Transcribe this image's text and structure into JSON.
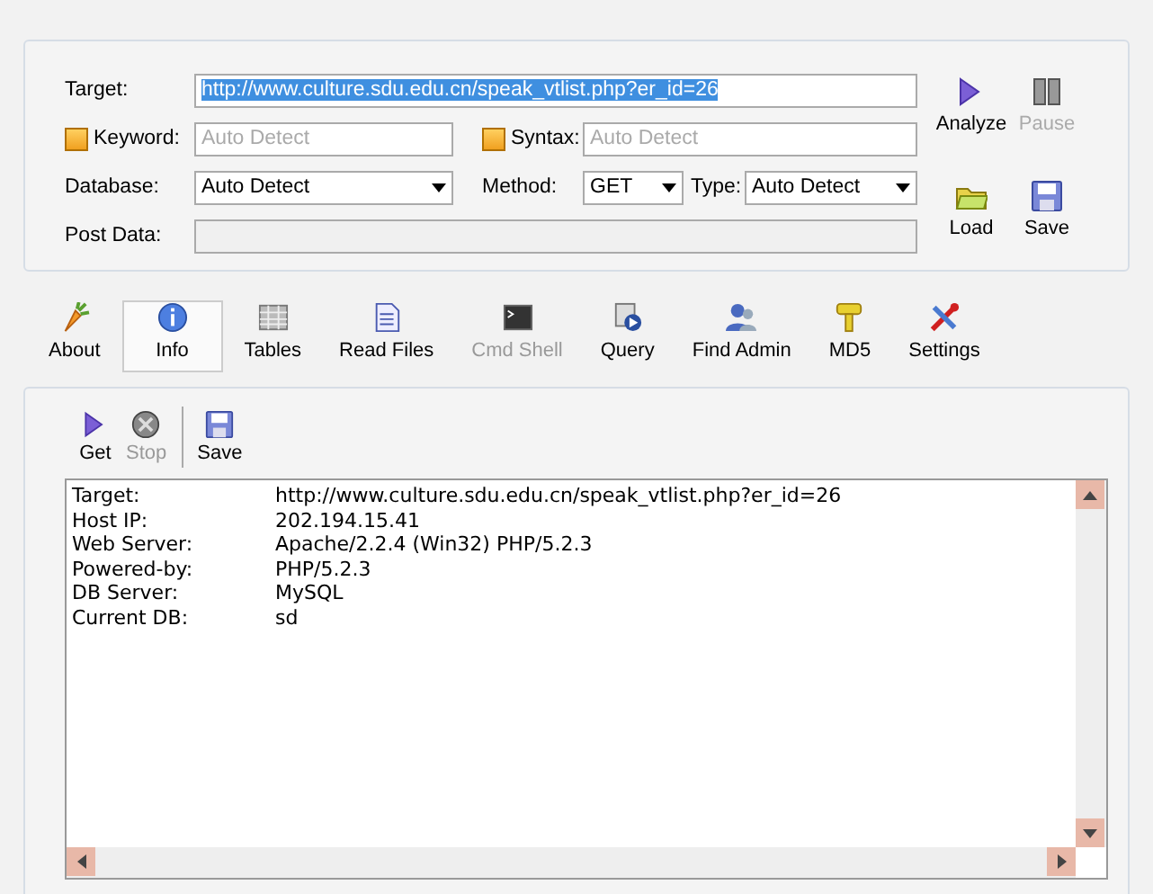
{
  "target": {
    "label": "Target:",
    "value": "http://www.culture.sdu.edu.cn/speak_vtlist.php?er_id=26",
    "selected": true
  },
  "keyword": {
    "label": "Keyword:",
    "checked": false,
    "placeholder": "Auto Detect"
  },
  "syntax": {
    "label": "Syntax:",
    "checked": false,
    "placeholder": "Auto Detect"
  },
  "database": {
    "label": "Database:",
    "value": "Auto Detect"
  },
  "method": {
    "label": "Method:",
    "value": "GET"
  },
  "type": {
    "label": "Type:",
    "value": "Auto Detect"
  },
  "post_data": {
    "label": "Post Data:"
  },
  "actions": [
    {
      "kind": "play",
      "label": "Analyze",
      "disabled": false
    },
    {
      "kind": "pause",
      "label": "Pause",
      "disabled": true
    },
    {
      "kind": "folder",
      "label": "Load",
      "disabled": false
    },
    {
      "kind": "disk",
      "label": "Save",
      "disabled": false
    }
  ],
  "tabs": [
    {
      "kind": "carrot",
      "label": "About",
      "selected": false,
      "disabled": false
    },
    {
      "kind": "info",
      "label": "Info",
      "selected": true,
      "disabled": false
    },
    {
      "kind": "table",
      "label": "Tables",
      "selected": false,
      "disabled": false
    },
    {
      "kind": "file",
      "label": "Read Files",
      "selected": false,
      "disabled": false
    },
    {
      "kind": "terminal",
      "label": "Cmd Shell",
      "selected": false,
      "disabled": true
    },
    {
      "kind": "query",
      "label": "Query",
      "selected": false,
      "disabled": false
    },
    {
      "kind": "user",
      "label": "Find Admin",
      "selected": false,
      "disabled": false
    },
    {
      "kind": "key",
      "label": "MD5",
      "selected": false,
      "disabled": false
    },
    {
      "kind": "tools",
      "label": "Settings",
      "selected": false,
      "disabled": false
    }
  ],
  "toolbar": [
    {
      "kind": "play",
      "label": "Get",
      "disabled": false
    },
    {
      "kind": "stop",
      "label": "Stop",
      "disabled": true
    },
    {
      "kind": "disk",
      "label": "Save",
      "disabled": false
    }
  ],
  "output": [
    {
      "label": "Target:",
      "value": "http://www.culture.sdu.edu.cn/speak_vtlist.php?er_id=26"
    },
    {
      "label": "Host IP:",
      "value": "202.194.15.41"
    },
    {
      "label": "Web Server:",
      "value": "Apache/2.2.4 (Win32) PHP/5.2.3"
    },
    {
      "label": "Powered-by:",
      "value": "PHP/5.2.3"
    },
    {
      "label": "DB Server:",
      "value": "MySQL"
    },
    {
      "label": "Current DB:",
      "value": "sd"
    }
  ]
}
